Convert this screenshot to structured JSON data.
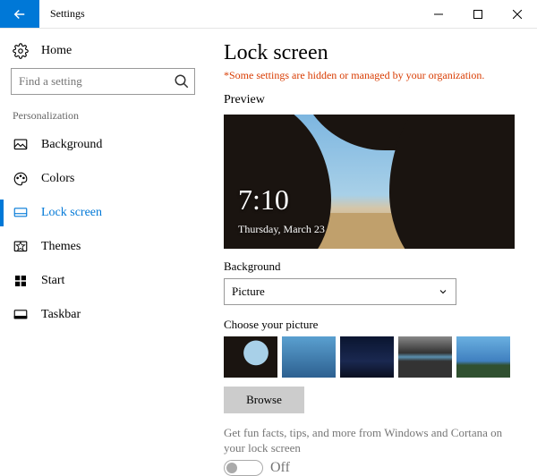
{
  "titlebar": {
    "title": "Settings"
  },
  "sidebar": {
    "home_label": "Home",
    "search_placeholder": "Find a setting",
    "group_header": "Personalization",
    "items": [
      {
        "label": "Background"
      },
      {
        "label": "Colors"
      },
      {
        "label": "Lock screen"
      },
      {
        "label": "Themes"
      },
      {
        "label": "Start"
      },
      {
        "label": "Taskbar"
      }
    ]
  },
  "main": {
    "page_title": "Lock screen",
    "org_message": "*Some settings are hidden or managed by your organization.",
    "preview_label": "Preview",
    "preview_time": "7:10",
    "preview_date": "Thursday, March 23",
    "background_label": "Background",
    "background_value": "Picture",
    "choose_label": "Choose your picture",
    "browse_label": "Browse",
    "toggle_label": "Get fun facts, tips, and more from Windows and Cortana on your lock screen",
    "toggle_state": "Off"
  }
}
